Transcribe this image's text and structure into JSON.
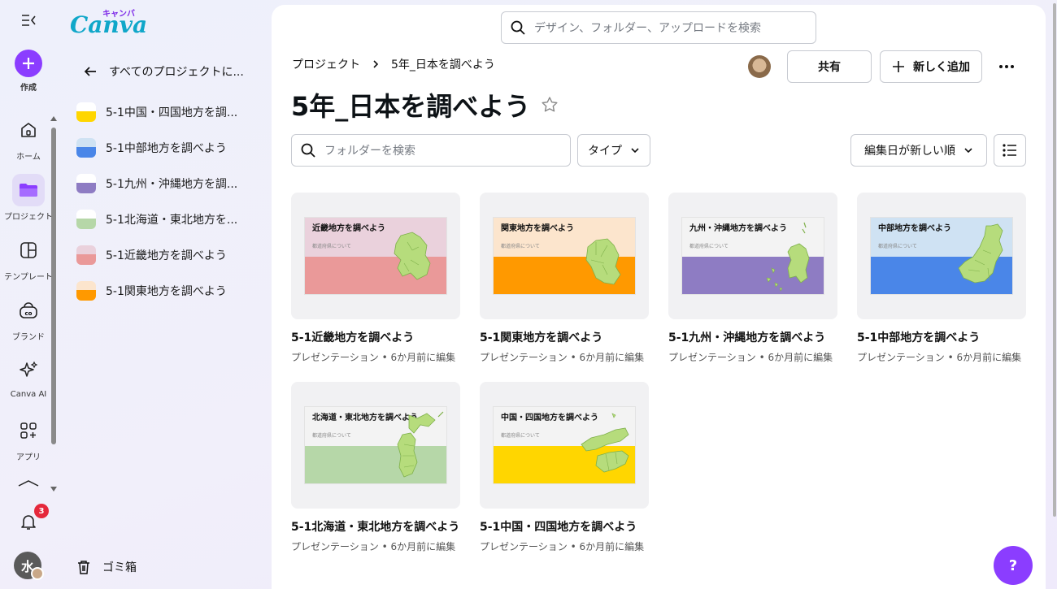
{
  "rail": {
    "create_label": "作成",
    "items": [
      {
        "label": "ホーム",
        "icon": "home-icon"
      },
      {
        "label": "プロジェクト",
        "icon": "folder-icon"
      },
      {
        "label": "テンプレート",
        "icon": "template-icon"
      },
      {
        "label": "ブランド",
        "icon": "brand-icon"
      },
      {
        "label": "Canva AI",
        "icon": "sparkle-icon"
      },
      {
        "label": "アプリ",
        "icon": "apps-icon"
      }
    ],
    "notification_count": "3",
    "avatar_initial": "水"
  },
  "panel": {
    "logo_text": "Canva",
    "logo_kana": "キャンバ",
    "back_label": "すべてのプロジェクトに...",
    "folders": [
      {
        "label": "5-1中国・四国地方を調...",
        "color": "#ffd600"
      },
      {
        "label": "5-1中部地方を調べよう",
        "color": "#4a86e8"
      },
      {
        "label": "5-1九州・沖縄地方を調...",
        "color": "#8e7cc3"
      },
      {
        "label": "5-1北海道・東北地方を...",
        "color": "#b6d7a8"
      },
      {
        "label": "5-1近畿地方を調べよう",
        "color": "#ea9999"
      },
      {
        "label": "5-1関東地方を調べよう",
        "color": "#ff9900"
      }
    ],
    "trash_label": "ゴミ箱"
  },
  "main": {
    "search_placeholder": "デザイン、フォルダー、アップロードを検索",
    "breadcrumb": {
      "root": "プロジェクト",
      "current": "5年_日本を調べよう"
    },
    "title": "5年_日本を調べよう",
    "share_label": "共有",
    "add_label": "新しく追加",
    "more_label": "•••",
    "folder_search_placeholder": "フォルダーを検索",
    "type_label": "タイプ",
    "sort_label": "編集日が新しい順",
    "colors": {
      "accent": "#8b3dff"
    },
    "cards": [
      {
        "title": "5-1近畿地方を調べよう",
        "meta": "プレゼンテーション • 6か月前に編集",
        "slide_title": "近畿地方を調べよう",
        "slide_sub": "都道府県について",
        "top": "#ead1dc",
        "bottom": "#ea9999"
      },
      {
        "title": "5-1関東地方を調べよう",
        "meta": "プレゼンテーション • 6か月前に編集",
        "slide_title": "関東地方を調べよう",
        "slide_sub": "都道府県について",
        "top": "#fce5cd",
        "bottom": "#ff9900"
      },
      {
        "title": "5-1九州・沖縄地方を調べよう",
        "meta": "プレゼンテーション • 6か月前に編集",
        "slide_title": "九州・沖縄地方を調べよう",
        "slide_sub": "都道府県について",
        "top": "#f3f3f3",
        "bottom": "#8e7cc3"
      },
      {
        "title": "5-1中部地方を調べよう",
        "meta": "プレゼンテーション • 6か月前に編集",
        "slide_title": "中部地方を調べよう",
        "slide_sub": "都道府県について",
        "top": "#cfe2f3",
        "bottom": "#4a86e8"
      },
      {
        "title": "5-1北海道・東北地方を調べよう",
        "meta": "プレゼンテーション • 6か月前に編集",
        "slide_title": "北海道・東北地方を調べよう",
        "slide_sub": "都道府県について",
        "top": "#f3f3f3",
        "bottom": "#b6d7a8"
      },
      {
        "title": "5-1中国・四国地方を調べよう",
        "meta": "プレゼンテーション • 6か月前に編集",
        "slide_title": "中国・四国地方を調べよう",
        "slide_sub": "都道府県について",
        "top": "#f3f3f3",
        "bottom": "#ffd600"
      }
    ]
  },
  "help_label": "?"
}
